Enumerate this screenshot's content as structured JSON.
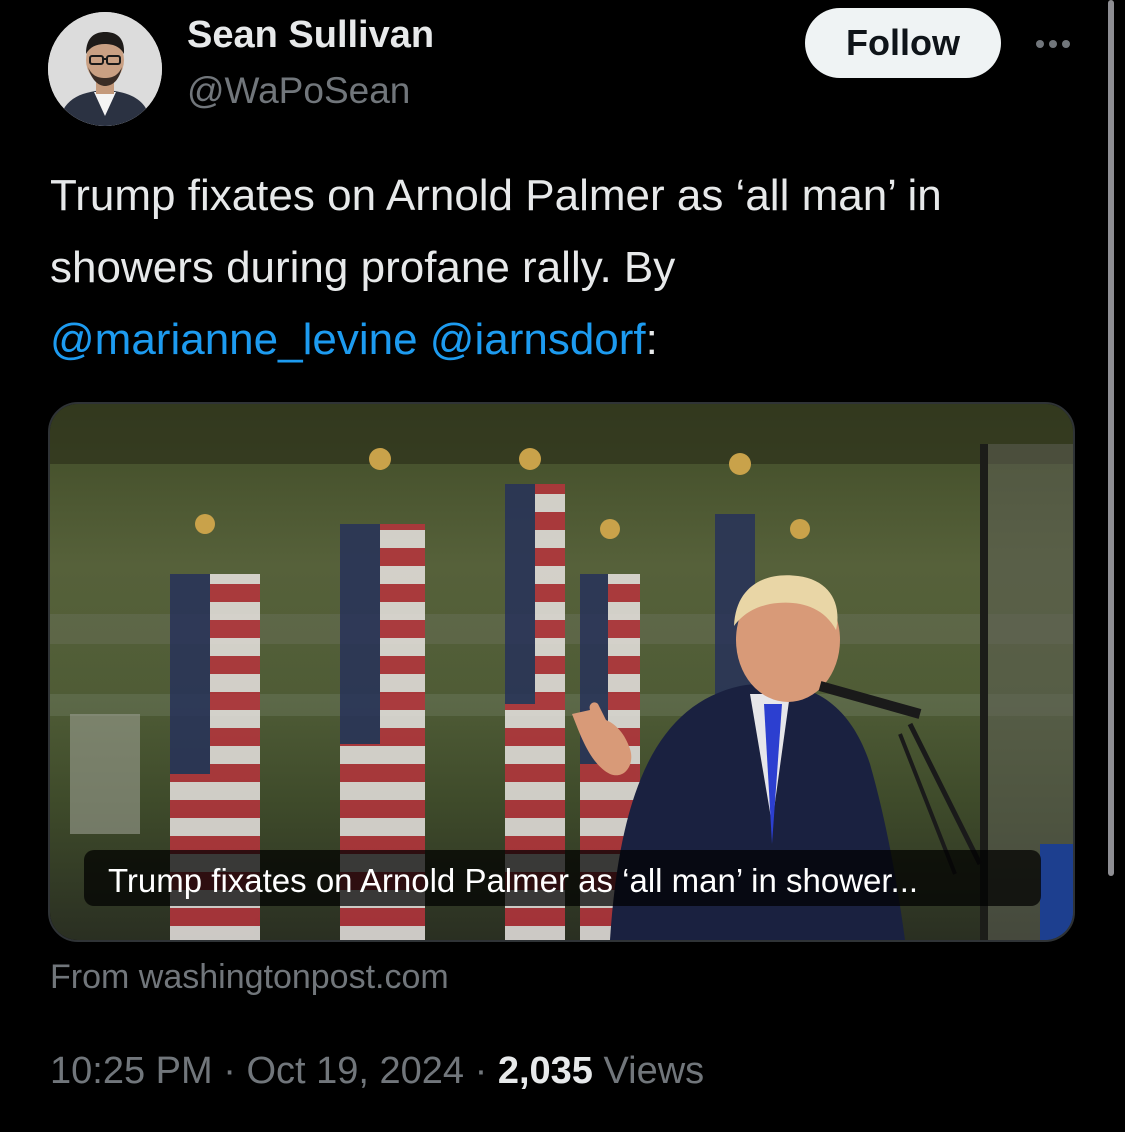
{
  "author": {
    "name": "Sean Sullivan",
    "handle": "@WaPoSean"
  },
  "actions": {
    "follow_label": "Follow",
    "more_icon": "more-horizontal-icon"
  },
  "tweet": {
    "text_main": "Trump fixates on Arnold Palmer as ‘all man’ in showers during profane rally. By",
    "mention_1": "@marianne_levine",
    "mention_2": "@iarnsdorf",
    "text_end": ":"
  },
  "card": {
    "caption": "Trump fixates on Arnold Palmer as ‘all man’ in shower...",
    "source": "From washingtonpost.com"
  },
  "meta": {
    "time": "10:25 PM",
    "separator": "·",
    "date": "Oct 19, 2024",
    "views_count": "2,035",
    "views_label": "Views"
  },
  "colors": {
    "background": "#000000",
    "link": "#1d9bf0",
    "muted": "#71767b",
    "text": "#e7e9ea"
  }
}
